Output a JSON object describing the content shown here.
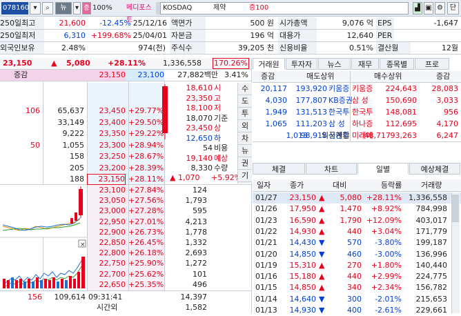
{
  "top": {
    "code": "078160",
    "category_btn": "뉴",
    "pct": "100%",
    "name": "메디포스트",
    "market": "KOSDAQ",
    "sector": "제약",
    "margin": "증100"
  },
  "info": [
    [
      {
        "t": "250일최고",
        "c": ""
      },
      {
        "t": "21,600",
        "c": "r"
      },
      {
        "t": "-12.45%",
        "c": "b"
      },
      {
        "t": "25/12/16",
        "c": ""
      },
      {
        "t": "액면가",
        "c": ""
      },
      {
        "t": "500 원",
        "c": ""
      },
      {
        "t": "시가총액",
        "c": ""
      },
      {
        "t": "9,076 억",
        "c": ""
      },
      {
        "t": "EPS",
        "c": ""
      },
      {
        "t": "-1,647",
        "c": ""
      }
    ],
    [
      {
        "t": "250일최저",
        "c": ""
      },
      {
        "t": "6,310",
        "c": "b"
      },
      {
        "t": "+199.68%",
        "c": "r"
      },
      {
        "t": "25/04/01",
        "c": ""
      },
      {
        "t": "자본금",
        "c": ""
      },
      {
        "t": "196 억",
        "c": ""
      },
      {
        "t": "대용가",
        "c": ""
      },
      {
        "t": "12,640",
        "c": ""
      },
      {
        "t": "PER",
        "c": ""
      },
      {
        "t": "",
        "c": ""
      }
    ],
    [
      {
        "t": "외국인보유",
        "c": ""
      },
      {
        "t": "2.48%",
        "c": ""
      },
      {
        "t": "974(천)",
        "c": ""
      },
      {
        "t": "주식수",
        "c": ""
      },
      {
        "t": "39,205 천",
        "c": ""
      },
      {
        "t": "신용비율",
        "c": ""
      },
      {
        "t": "0.51%",
        "c": ""
      },
      {
        "t": "결산월",
        "c": ""
      },
      {
        "t": "12월",
        "c": ""
      }
    ]
  ],
  "price": {
    "current": "23,150",
    "arrow": "▲",
    "change": "5,080",
    "pct": "+28.11%",
    "volume": "1,336,558",
    "vol_pct": "170.26%"
  },
  "bidask_header": {
    "label": "증감",
    "ask": "23,150",
    "bid": "23,100",
    "amount": "27,882백만",
    "ratio": "3.41%"
  },
  "asks": [
    {
      "chg": "",
      "qty": "",
      "price": "",
      "pct": ""
    },
    {
      "chg": "",
      "qty": "",
      "price": "",
      "pct": ""
    },
    {
      "chg": "106",
      "qty": "65,637",
      "price": "23,450",
      "pct": "+29.77%"
    },
    {
      "chg": "",
      "qty": "33,149",
      "price": "23,400",
      "pct": "+29.50%"
    },
    {
      "chg": "",
      "qty": "9,222",
      "price": "23,350",
      "pct": "+29.22%"
    },
    {
      "chg": "50",
      "qty": "1,055",
      "price": "23,300",
      "pct": "+28.94%"
    },
    {
      "chg": "",
      "qty": "158",
      "price": "23,250",
      "pct": "+28.67%"
    },
    {
      "chg": "",
      "qty": "205",
      "price": "23,200",
      "pct": "+28.39%"
    },
    {
      "chg": "",
      "qty": "188",
      "price": "23,150",
      "pct": "+28.11%"
    }
  ],
  "bids": [
    {
      "price": "23,100",
      "pct": "+27.84%",
      "qty": "124"
    },
    {
      "price": "23,050",
      "pct": "+27.56%",
      "qty": "1,793"
    },
    {
      "price": "23,000",
      "pct": "+27.28%",
      "qty": "595"
    },
    {
      "price": "22,950",
      "pct": "+27.01%",
      "qty": "4,213"
    },
    {
      "price": "22,900",
      "pct": "+26.73%",
      "qty": "1,778"
    },
    {
      "price": "22,850",
      "pct": "+26.45%",
      "qty": "1,332"
    },
    {
      "price": "22,800",
      "pct": "+26.18%",
      "qty": "2,693"
    },
    {
      "price": "22,750",
      "pct": "+25.90%",
      "qty": "1,272"
    },
    {
      "price": "22,700",
      "pct": "+25.62%",
      "qty": "101"
    },
    {
      "price": "22,650",
      "pct": "+25.35%",
      "qty": "496"
    }
  ],
  "summary": {
    "vals": [
      {
        "v": "18,610",
        "l": "시",
        "c": "r"
      },
      {
        "v": "23,350",
        "l": "고",
        "c": "r"
      },
      {
        "v": "18,100",
        "l": "저",
        "c": "r"
      },
      {
        "v": "18,070",
        "l": "기준",
        "c": ""
      },
      {
        "v": "23,450",
        "l": "상",
        "c": "r"
      },
      {
        "v": "12,650",
        "l": "하",
        "c": "b"
      },
      {
        "v": "54",
        "l": "비용",
        "c": ""
      },
      {
        "v": "19,140",
        "l": "예상",
        "c": "r"
      },
      {
        "v": "8,330",
        "l": "수량",
        "c": ""
      }
    ],
    "exp_arrow": "▲",
    "exp_chg": "1,070",
    "exp_pct": "+5.92%"
  },
  "side_buttons": [
    "수",
    "도",
    "투",
    "외",
    "차",
    "뉴",
    "권",
    "기"
  ],
  "footer": {
    "chg": "156",
    "qty": "109,614",
    "time": "09:31:41",
    "bid_total": "14,397",
    "time_label": "시간외",
    "after": "1,582"
  },
  "broker_tabs": [
    "거래원",
    "투자자",
    "뉴스",
    "재무",
    "종목별",
    "프로"
  ],
  "broker_head": {
    "c1": "증감",
    "c2": "매도상위",
    "c3": "매수상위",
    "c4": "증감"
  },
  "brokers": [
    {
      "a": "20,117",
      "b": "193,920",
      "n1": "키움증",
      "n2": "키움증",
      "c": "224,643",
      "d": "28,083"
    },
    {
      "a": "4,030",
      "b": "177,807",
      "n1": "KB증권",
      "n2": "삼 성",
      "c": "150,690",
      "d": "3,033"
    },
    {
      "a": "1,949",
      "b": "131,513",
      "n1": "한국투",
      "n2": "한국투",
      "c": "148,081",
      "d": "956"
    },
    {
      "a": "1,065",
      "b": "111,203",
      "n1": "삼 성",
      "n2": "하나증",
      "c": "112,695",
      "d": "4,170"
    },
    {
      "a": "",
      "b": "98,915",
      "n1": "신한투",
      "n2": "미래에",
      "c": "93,263",
      "d": "6,247"
    }
  ],
  "foreign": {
    "a": "1,013",
    "label": "외국계합",
    "b": "48,717"
  },
  "lower_tabs": [
    "체결",
    "차트",
    "일별",
    "예상체결"
  ],
  "daily_head": [
    "일자",
    "종가",
    "대비",
    "등락률",
    "거래량"
  ],
  "daily": [
    {
      "d": "01/27",
      "p": "23,150",
      "ar": "▲",
      "ch": "5,080",
      "pc": "+28.11%",
      "v": "1,336,558",
      "c": "r"
    },
    {
      "d": "01/26",
      "p": "17,950",
      "ar": "▲",
      "ch": "1,470",
      "pc": "+8.92%",
      "v": "784,998",
      "c": "r"
    },
    {
      "d": "01/23",
      "p": "16,590",
      "ar": "▲",
      "ch": "1,790",
      "pc": "+12.09%",
      "v": "403,017",
      "c": "r"
    },
    {
      "d": "01/22",
      "p": "14,930",
      "ar": "▲",
      "ch": "440",
      "pc": "+3.04%",
      "v": "171,779",
      "c": "r"
    },
    {
      "d": "01/21",
      "p": "14,430",
      "ar": "▼",
      "ch": "570",
      "pc": "-3.80%",
      "v": "199,187",
      "c": "b"
    },
    {
      "d": "01/20",
      "p": "14,850",
      "ar": "▼",
      "ch": "460",
      "pc": "-3.00%",
      "v": "136,996",
      "c": "b"
    },
    {
      "d": "01/19",
      "p": "15,310",
      "ar": "▲",
      "ch": "270",
      "pc": "+1.80%",
      "v": "140,440",
      "c": "r"
    },
    {
      "d": "01/16",
      "p": "15,180",
      "ar": "▲",
      "ch": "440",
      "pc": "+2.99%",
      "v": "224,775",
      "c": "r"
    },
    {
      "d": "01/15",
      "p": "14,850",
      "ar": "▲",
      "ch": "340",
      "pc": "+2.34%",
      "v": "156,782",
      "c": "r"
    },
    {
      "d": "01/14",
      "p": "14,640",
      "ar": "▼",
      "ch": "300",
      "pc": "-2.01%",
      "v": "215,653",
      "c": "b"
    },
    {
      "d": "01/13",
      "p": "14,930",
      "ar": "▼",
      "ch": "400",
      "pc": "-2.61%",
      "v": "229,661",
      "c": "b"
    }
  ]
}
